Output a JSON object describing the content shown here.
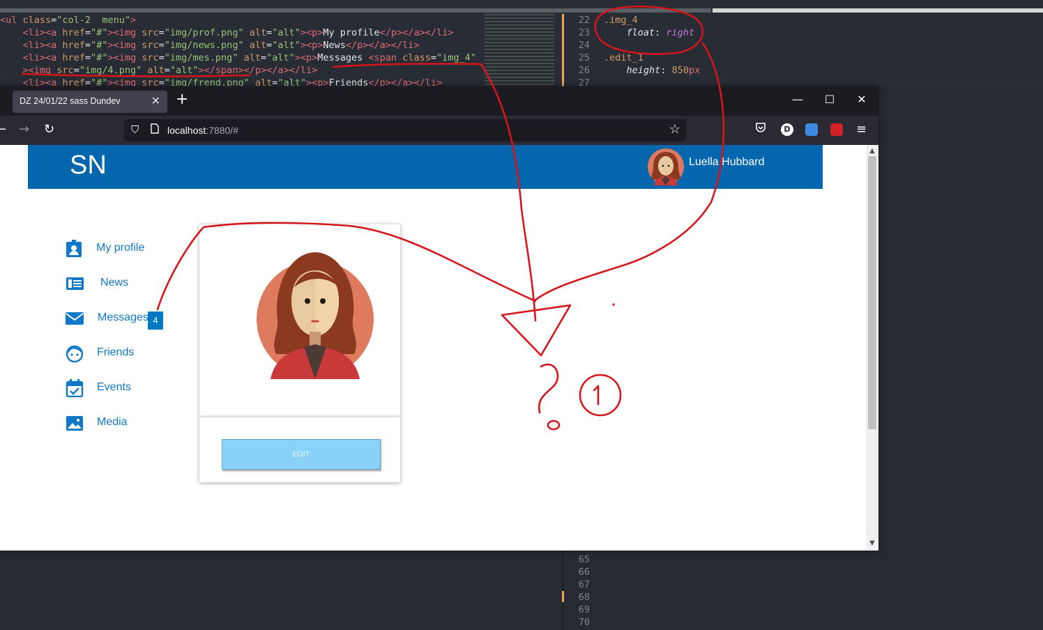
{
  "editor": {
    "left_lines": [
      [
        [
          "t-tag",
          "<ul "
        ],
        [
          "t-attr",
          "class"
        ],
        [
          "t-txt",
          "="
        ],
        [
          "t-str",
          "\"col-2  menu\""
        ],
        [
          "t-tag",
          ">"
        ]
      ],
      [
        [
          "t-txt",
          "    "
        ],
        [
          "t-tag",
          "<li><a "
        ],
        [
          "t-attr",
          "href"
        ],
        [
          "t-txt",
          "="
        ],
        [
          "t-str",
          "\"#\""
        ],
        [
          "t-tag",
          "><img "
        ],
        [
          "t-attr",
          "src"
        ],
        [
          "t-txt",
          "="
        ],
        [
          "t-str",
          "\"img/prof.png\" "
        ],
        [
          "t-attr",
          "alt"
        ],
        [
          "t-txt",
          "="
        ],
        [
          "t-str",
          "\"alt\""
        ],
        [
          "t-tag",
          "><p>"
        ],
        [
          "t-txt",
          "My profile"
        ],
        [
          "t-tag",
          "</p></a></li>"
        ]
      ],
      [
        [
          "t-txt",
          "    "
        ],
        [
          "t-tag",
          "<li><a "
        ],
        [
          "t-attr",
          "href"
        ],
        [
          "t-txt",
          "="
        ],
        [
          "t-str",
          "\"#\""
        ],
        [
          "t-tag",
          "><img "
        ],
        [
          "t-attr",
          "src"
        ],
        [
          "t-txt",
          "="
        ],
        [
          "t-str",
          "\"img/news.png\" "
        ],
        [
          "t-attr",
          "alt"
        ],
        [
          "t-txt",
          "="
        ],
        [
          "t-str",
          "\"alt\""
        ],
        [
          "t-tag",
          "><p>"
        ],
        [
          "t-txt",
          "News"
        ],
        [
          "t-tag",
          "</p></a></li>"
        ]
      ],
      [
        [
          "t-txt",
          "    "
        ],
        [
          "t-tag",
          "<li><a "
        ],
        [
          "t-attr",
          "href"
        ],
        [
          "t-txt",
          "="
        ],
        [
          "t-str",
          "\"#\""
        ],
        [
          "t-tag",
          "><img "
        ],
        [
          "t-attr",
          "src"
        ],
        [
          "t-txt",
          "="
        ],
        [
          "t-str",
          "\"img/mes.png\" "
        ],
        [
          "t-attr",
          "alt"
        ],
        [
          "t-txt",
          "="
        ],
        [
          "t-str",
          "\"alt\""
        ],
        [
          "t-tag",
          "><p>"
        ],
        [
          "t-txt",
          "Messages "
        ],
        [
          "t-tag",
          "<span "
        ],
        [
          "t-attr",
          "class"
        ],
        [
          "t-txt",
          "="
        ],
        [
          "t-str",
          "\"img_4\""
        ]
      ],
      [
        [
          "t-txt",
          "    "
        ],
        [
          "t-tag",
          "><img "
        ],
        [
          "t-attr",
          "src"
        ],
        [
          "t-txt",
          "="
        ],
        [
          "t-str",
          "\"img/4.png\" "
        ],
        [
          "t-attr",
          "alt"
        ],
        [
          "t-txt",
          "="
        ],
        [
          "t-str",
          "\"alt\""
        ],
        [
          "t-tag",
          "></span></p></a></li>"
        ]
      ],
      [
        [
          "t-txt",
          "    "
        ],
        [
          "t-tag",
          "<li><a "
        ],
        [
          "t-attr",
          "href"
        ],
        [
          "t-txt",
          "="
        ],
        [
          "t-str",
          "\"#\""
        ],
        [
          "t-tag",
          "><img "
        ],
        [
          "t-attr",
          "src"
        ],
        [
          "t-txt",
          "="
        ],
        [
          "t-str",
          "\"img/frend.png\" "
        ],
        [
          "t-attr",
          "alt"
        ],
        [
          "t-txt",
          "="
        ],
        [
          "t-str",
          "\"alt\""
        ],
        [
          "t-tag",
          "><p>"
        ],
        [
          "t-txt",
          "Friends"
        ],
        [
          "t-tag",
          "</p></a></li>"
        ]
      ]
    ],
    "right_lines": [
      {
        "num": "22",
        "parts": [
          [
            "t-sel",
            ".img_4"
          ]
        ]
      },
      {
        "num": "23",
        "parts": [
          [
            "t-txt",
            "    "
          ],
          [
            "t-prop",
            "float"
          ],
          [
            "t-txt",
            ": "
          ],
          [
            "t-val",
            "right"
          ]
        ]
      },
      {
        "num": "24",
        "parts": []
      },
      {
        "num": "25",
        "parts": [
          [
            "t-sel",
            ".edit_1"
          ]
        ]
      },
      {
        "num": "26",
        "parts": [
          [
            "t-txt",
            "    "
          ],
          [
            "t-prop",
            "height"
          ],
          [
            "t-txt",
            ": "
          ],
          [
            "t-numv",
            "850"
          ],
          [
            "t-unit",
            "px"
          ]
        ]
      },
      {
        "num": "27",
        "parts": []
      }
    ],
    "bottom_line_numbers": [
      "65",
      "66",
      "67",
      "68",
      "69",
      "70"
    ]
  },
  "browser": {
    "tab_title": "DZ 24/01/22 sass Dundev",
    "tab_close": "✕",
    "new_tab": "+",
    "url_host": "localhost",
    "url_rest": ":7880/#",
    "minimize": "—",
    "maximize": "☐",
    "close": "✕"
  },
  "page": {
    "logo": "SN",
    "user_name": "Luella Hubbard",
    "menu": [
      {
        "label": "My profile",
        "icon": "profile-icon"
      },
      {
        "label": "News",
        "icon": "news-icon"
      },
      {
        "label": "Messages",
        "icon": "mail-icon",
        "badge": "4"
      },
      {
        "label": "Friends",
        "icon": "friends-icon"
      },
      {
        "label": "Events",
        "icon": "calendar-icon"
      },
      {
        "label": "Media",
        "icon": "image-icon"
      }
    ],
    "edit_button": "EDIT"
  },
  "colors": {
    "header": "#0466ad",
    "link": "#0f78c8",
    "edit_button": "#87d2f6",
    "annotation": "#d4161c"
  }
}
